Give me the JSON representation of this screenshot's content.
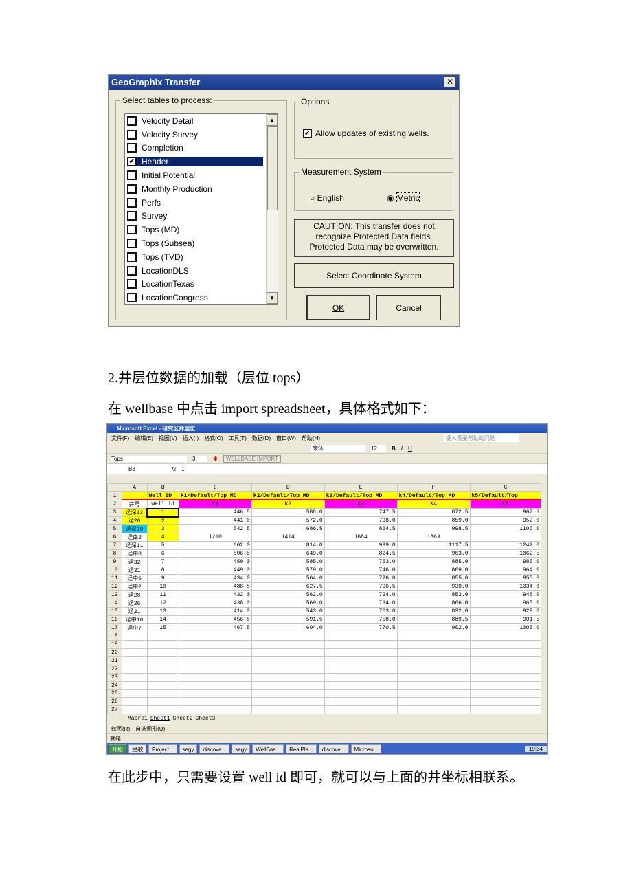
{
  "dialog": {
    "title": "GeoGraphix Transfer",
    "tables_legend": "Select tables to process:",
    "tables": [
      {
        "label": "Velocity Detail",
        "checked": false
      },
      {
        "label": "Velocity Survey",
        "checked": false
      },
      {
        "label": "Completion",
        "checked": false
      },
      {
        "label": "Header",
        "checked": true
      },
      {
        "label": "Initial Potential",
        "checked": false
      },
      {
        "label": "Monthly Production",
        "checked": false
      },
      {
        "label": "Perfs",
        "checked": false
      },
      {
        "label": "Survey",
        "checked": false
      },
      {
        "label": "Tops (MD)",
        "checked": false
      },
      {
        "label": "Tops (Subsea)",
        "checked": false
      },
      {
        "label": "Tops (TVD)",
        "checked": false
      },
      {
        "label": "LocationDLS",
        "checked": false
      },
      {
        "label": "LocationTexas",
        "checked": false
      },
      {
        "label": "LocationCongress",
        "checked": false
      }
    ],
    "options_legend": "Options",
    "allow_updates": "Allow updates of existing wells.",
    "allow_updates_checked": true,
    "measurement_legend": "Measurement System",
    "english": "English",
    "metric": "Metric",
    "selected_system": "Metric",
    "caution": "CAUTION:  This transfer does not recognize Protected Data fields. Protected Data may be overwritten.",
    "select_coord": "Select Coordinate System",
    "ok": "OK",
    "cancel": "Cancel"
  },
  "section_heading": "2.井层位数据的加载（层位 tops）",
  "paragraph1": "在 wellbase 中点击 import spreadsheet，具体格式如下：",
  "paragraph2": "在此步中，只需要设置 well id 即可，就可以与上面的井坐标相联系。",
  "excel": {
    "title": "Microsoft Excel - 研究区井层位",
    "menu": [
      "文件(F)",
      "编辑(E)",
      "视图(V)",
      "插入(I)",
      "格式(O)",
      "工具(T)",
      "数据(D)",
      "窗口(W)",
      "帮助(H)"
    ],
    "help_placeholder": "键入需要帮助的问题",
    "font": "宋体",
    "font_size": "12",
    "toolbar2_select": "Tops",
    "toolbar2_num": "3",
    "wellbase_btn": "WELLBASE IMPORT",
    "cell_ref": "B3",
    "formula": "1",
    "columns": [
      "A",
      "B",
      "C",
      "D",
      "E",
      "F",
      "G"
    ],
    "header_row": [
      "",
      "Well ID",
      "k1/Default/Top MD",
      "k2/Default/Top MD",
      "k3/Default/Top MD",
      "k4/Default/Top MD",
      "k5/Default/Top"
    ],
    "row2": [
      "井号",
      "well id",
      "K1",
      "K2",
      "K3",
      "K4",
      "K5"
    ],
    "rows": [
      [
        "迳深13",
        "1",
        "446.5",
        "588.0",
        "747.5",
        "872.5",
        "967.5"
      ],
      [
        "迳20",
        "2",
        "441.0",
        "572.0",
        "738.0",
        "859.0",
        "952.0"
      ],
      [
        "迳深10",
        "3",
        "542.5",
        "686.5",
        "864.5",
        "998.5",
        "1100.0"
      ],
      [
        "迳南2",
        "4",
        "1210",
        "1414",
        "1684",
        "1863",
        ""
      ],
      [
        "迳深11",
        "5",
        "662.0",
        "814.0",
        "999.0",
        "1117.5",
        "1242.0"
      ],
      [
        "迳中8",
        "6",
        "506.5",
        "649.0",
        "824.5",
        "963.0",
        "1062.5"
      ],
      [
        "迳32",
        "7",
        "450.0",
        "585.0",
        "753.0",
        "885.0",
        "985.0"
      ],
      [
        "迳31",
        "8",
        "449.0",
        "579.0",
        "746.0",
        "869.0",
        "964.0"
      ],
      [
        "迳中6",
        "9",
        "434.0",
        "564.0",
        "726.0",
        "855.0",
        "955.0"
      ],
      [
        "迳中2",
        "10",
        "488.5",
        "627.5",
        "796.5",
        "930.0",
        "1034.0"
      ],
      [
        "迳28",
        "11",
        "432.0",
        "562.0",
        "724.0",
        "853.0",
        "948.0"
      ],
      [
        "迳26",
        "12",
        "438.0",
        "569.0",
        "734.0",
        "866.0",
        "965.0"
      ],
      [
        "迳21",
        "13",
        "414.0",
        "543.0",
        "703.0",
        "832.0",
        "929.0"
      ],
      [
        "迳中10",
        "14",
        "456.5",
        "591.5",
        "758.0",
        "889.5",
        "991.5"
      ],
      [
        "迳中7",
        "15",
        "467.5",
        "604.0",
        "770.5",
        "902.0",
        "1005.0"
      ]
    ],
    "empty_rows": [
      "18",
      "19",
      "20",
      "21",
      "22",
      "23",
      "24",
      "25",
      "26",
      "27"
    ],
    "sheets": [
      "Macro1",
      "Sheet1",
      "Sheet2",
      "Sheet3"
    ],
    "draw_label": "绘图(R)",
    "autoshape_label": "自选图形(U)",
    "status": "就绪",
    "taskbar": [
      "开始",
      "民歌",
      "Project...",
      "segy",
      "discove...",
      "segy",
      "WellBas...",
      "RealPla...",
      "discove...",
      "Microso..."
    ],
    "clock": "19:34",
    "colors": {
      "yellow": "#ffff00",
      "magenta": "#ff00ff",
      "cyan": "#00ccff"
    }
  }
}
